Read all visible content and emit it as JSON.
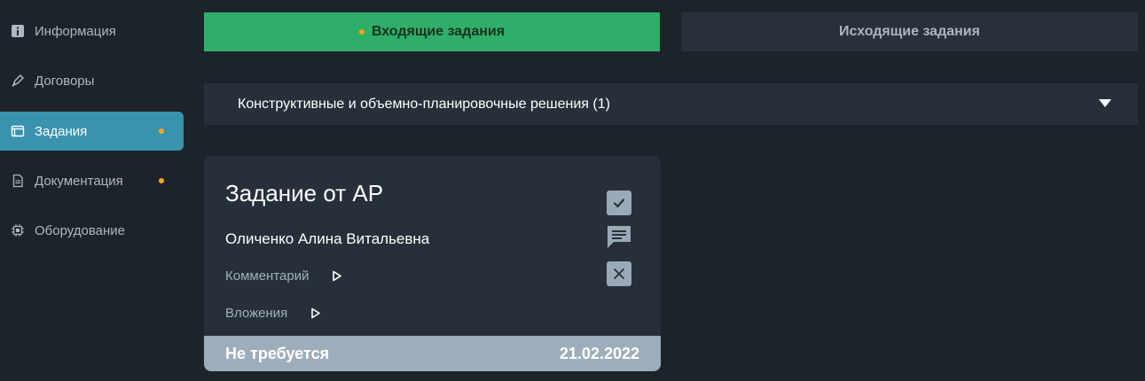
{
  "sidebar": {
    "items": [
      {
        "label": "Информация",
        "icon": "info-icon",
        "active": false,
        "dot": false
      },
      {
        "label": "Договоры",
        "icon": "pen-icon",
        "active": false,
        "dot": false
      },
      {
        "label": "Задания",
        "icon": "window-icon",
        "active": true,
        "dot": true
      },
      {
        "label": "Документация",
        "icon": "document-icon",
        "active": false,
        "dot": true
      },
      {
        "label": "Оборудование",
        "icon": "chip-icon",
        "active": false,
        "dot": false
      }
    ]
  },
  "tabs": {
    "incoming": "Входящие задания",
    "outgoing": "Исходящие задания"
  },
  "accordion": {
    "title": "Конструктивные и объемно-планировочные решения (1)"
  },
  "card": {
    "title": "Задание от АР",
    "person": "Оличенко Алина Витальевна",
    "comment_label": "Комментарий",
    "attachments_label": "Вложения",
    "status": "Не требуется",
    "date": "21.02.2022"
  },
  "colors": {
    "accent_active_nav": "#3a93ad",
    "tab_active": "#2fae69",
    "notification_dot": "#f5a623",
    "card_footer": "#9eadba"
  }
}
